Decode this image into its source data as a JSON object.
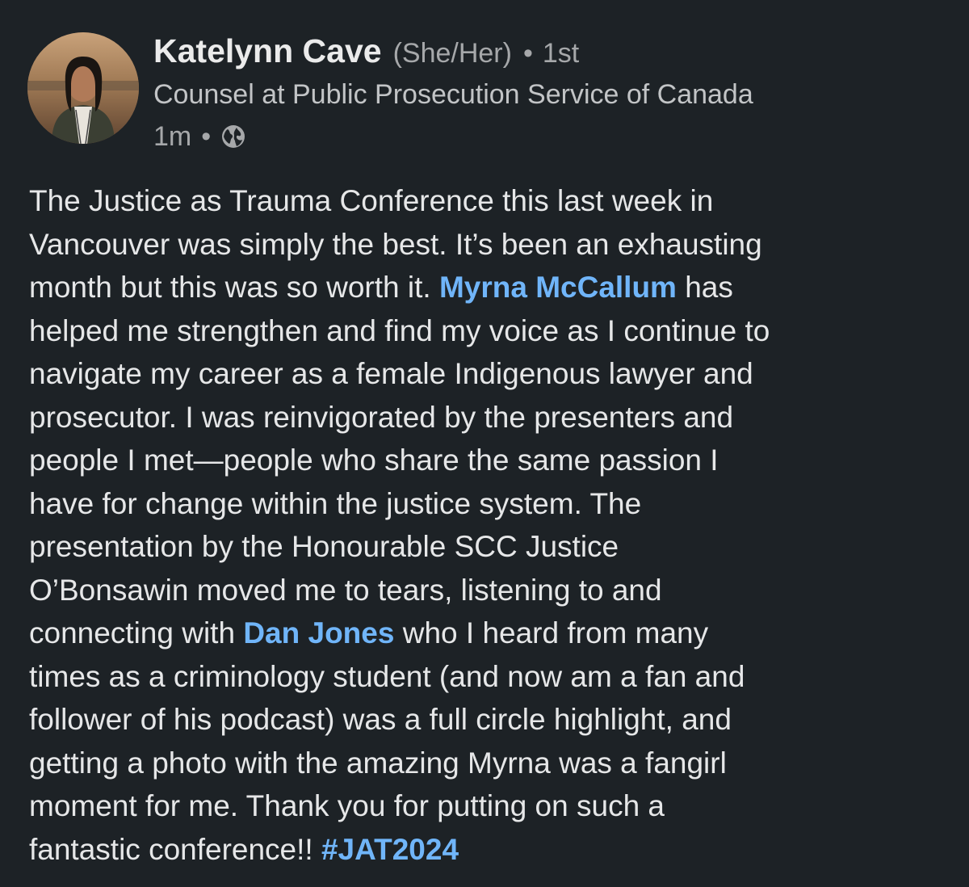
{
  "author": {
    "name": "Katelynn Cave",
    "pronouns": "(She/Her)",
    "separator": "•",
    "connection_degree": "1st",
    "headline": "Counsel at Public Prosecution Service of Canada",
    "timestamp": "1m",
    "visibility_icon": "globe-icon"
  },
  "post": {
    "lines": [
      [
        {
          "text": "The Justice as Trauma Conference this last week in"
        }
      ],
      [
        {
          "text": "Vancouver was simply the best. It’s been an exhausting"
        }
      ],
      [
        {
          "text": "month but this was so worth it. "
        },
        {
          "text": "Myrna McCallum",
          "type": "mention"
        },
        {
          "text": " has"
        }
      ],
      [
        {
          "text": "helped me strengthen and find my voice as I continue to"
        }
      ],
      [
        {
          "text": "navigate my career as a female Indigenous lawyer and"
        }
      ],
      [
        {
          "text": "prosecutor. I was reinvigorated by the presenters and"
        }
      ],
      [
        {
          "text": "people I met—people who share the same passion I"
        }
      ],
      [
        {
          "text": "have for change within the justice system. The"
        }
      ],
      [
        {
          "text": "presentation by the Honourable SCC Justice"
        }
      ],
      [
        {
          "text": "O’Bonsawin moved me to tears, listening to and"
        }
      ],
      [
        {
          "text": "connecting with "
        },
        {
          "text": "Dan Jones",
          "type": "mention"
        },
        {
          "text": " who I heard from many"
        }
      ],
      [
        {
          "text": "times as a criminology student (and now am a fan and"
        }
      ],
      [
        {
          "text": "follower of his podcast) was a full circle highlight, and"
        }
      ],
      [
        {
          "text": "getting a photo with the amazing Myrna was a fangirl"
        }
      ],
      [
        {
          "text": "moment for me. Thank you for putting on such a"
        }
      ],
      [
        {
          "text": "fantastic conference!! "
        },
        {
          "text": "#JAT2024",
          "type": "hashtag"
        }
      ]
    ]
  },
  "colors": {
    "background": "#1d2226",
    "link": "#70b5f9",
    "text": "#e6e7e8",
    "muted": "#a6a8aa"
  }
}
